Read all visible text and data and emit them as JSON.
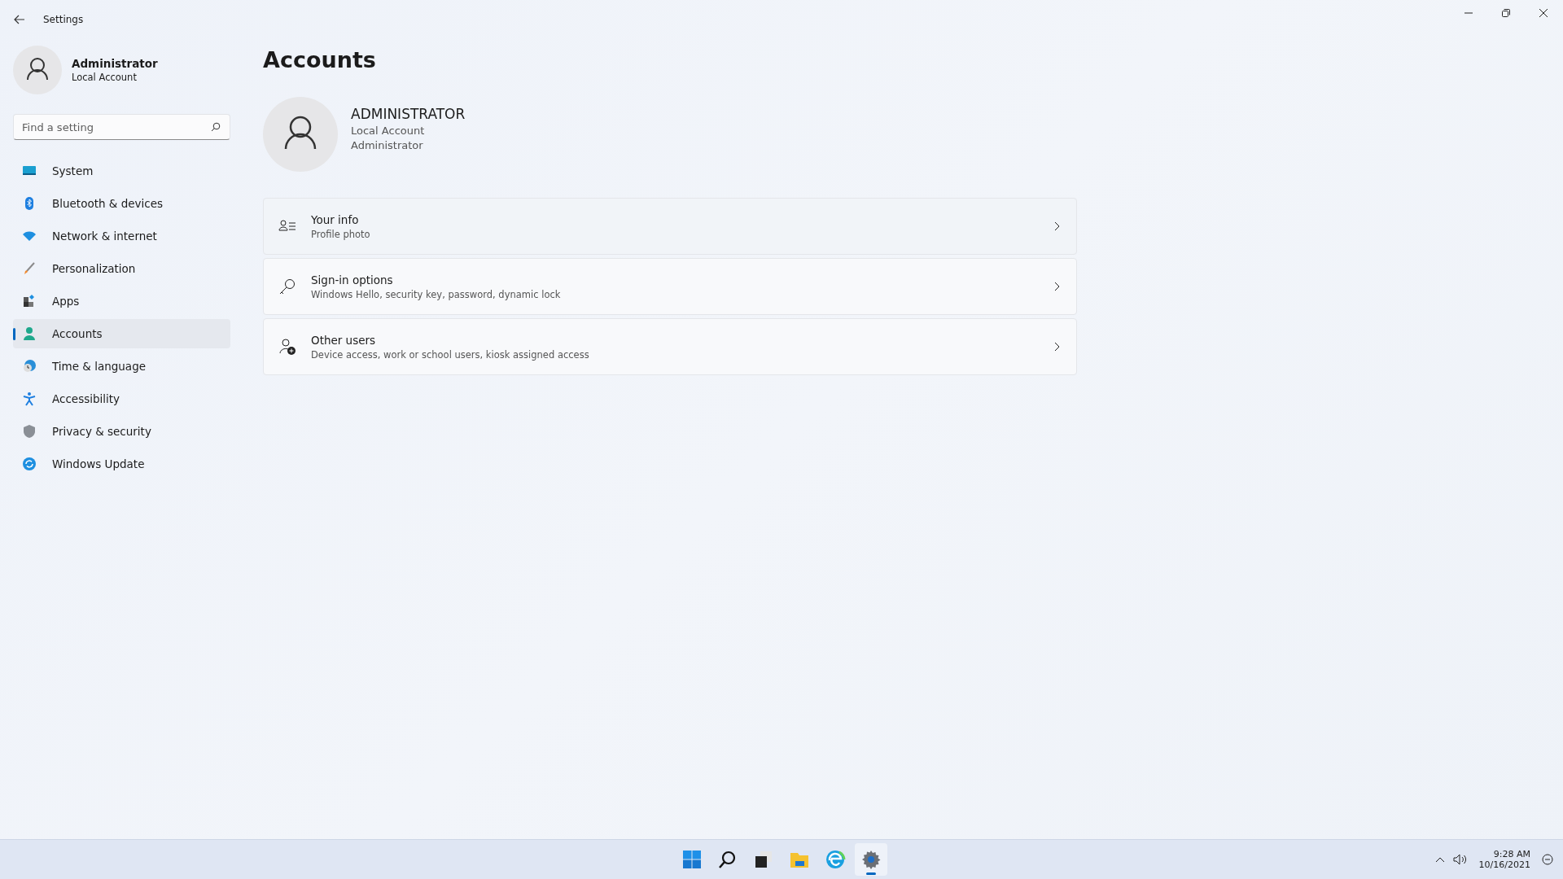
{
  "window": {
    "title": "Settings"
  },
  "profile": {
    "name": "Administrator",
    "account_type": "Local Account"
  },
  "search": {
    "placeholder": "Find a setting"
  },
  "sidebar": {
    "items": [
      {
        "label": "System",
        "selected": false
      },
      {
        "label": "Bluetooth & devices",
        "selected": false
      },
      {
        "label": "Network & internet",
        "selected": false
      },
      {
        "label": "Personalization",
        "selected": false
      },
      {
        "label": "Apps",
        "selected": false
      },
      {
        "label": "Accounts",
        "selected": true
      },
      {
        "label": "Time & language",
        "selected": false
      },
      {
        "label": "Accessibility",
        "selected": false
      },
      {
        "label": "Privacy & security",
        "selected": false
      },
      {
        "label": "Windows Update",
        "selected": false
      }
    ]
  },
  "page": {
    "title": "Accounts",
    "user": {
      "name": "ADMINISTRATOR",
      "lines": [
        "Local Account",
        "Administrator"
      ]
    },
    "cards": [
      {
        "title": "Your info",
        "subtitle": "Profile photo"
      },
      {
        "title": "Sign-in options",
        "subtitle": "Windows Hello, security key, password, dynamic lock"
      },
      {
        "title": "Other users",
        "subtitle": "Device access, work or school users, kiosk assigned access"
      }
    ]
  },
  "taskbar": {
    "apps": [
      {
        "selected": false
      },
      {
        "selected": false
      },
      {
        "selected": false
      },
      {
        "selected": false
      },
      {
        "selected": false
      },
      {
        "selected": true
      }
    ],
    "time": "9:28 AM",
    "date": "10/16/2021"
  }
}
